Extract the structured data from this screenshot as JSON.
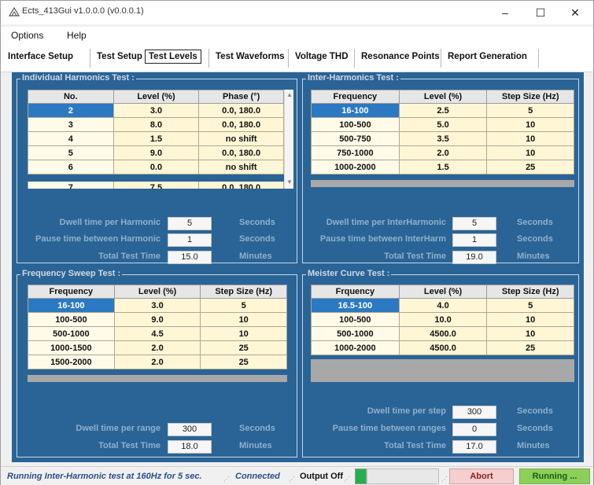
{
  "window": {
    "title": "Ects_413Gui v1.0.0.0 (v0.0.0.1)",
    "minimize": "–",
    "maximize": "☐",
    "close": "✕"
  },
  "menu": [
    "Options",
    "Help"
  ],
  "tabs": [
    "Interface Setup",
    "Test Setup",
    "Test Levels",
    "Test Waveforms",
    "Voltage THD",
    "Resonance Points",
    "Report Generation"
  ],
  "active_tab": "Test Levels",
  "individual": {
    "title": "Individual Harmonics Test :",
    "headers": [
      "No.",
      "Level (%)",
      "Phase (°)"
    ],
    "rows": [
      [
        "2",
        "3.0",
        "0.0, 180.0"
      ],
      [
        "3",
        "8.0",
        "0.0, 180.0"
      ],
      [
        "4",
        "1.5",
        "no shift"
      ],
      [
        "5",
        "9.0",
        "0.0, 180.0"
      ],
      [
        "6",
        "0.0",
        "no shift"
      ],
      [
        "7",
        "7.5",
        "0.0, 180.0"
      ]
    ],
    "dwell_label": "Dwell time per Harmonic",
    "dwell_value": "5",
    "dwell_unit": "Seconds",
    "pause_label": "Pause time between Harmonic",
    "pause_value": "1",
    "pause_unit": "Seconds",
    "total_label": "Total Test Time",
    "total_value": "15.0",
    "total_unit": "Minutes"
  },
  "inter": {
    "title": "Inter-Harmonics Test :",
    "headers": [
      "Frequency",
      "Level (%)",
      "Step Size (Hz)"
    ],
    "rows": [
      [
        "16-100",
        "2.5",
        "5"
      ],
      [
        "100-500",
        "5.0",
        "10"
      ],
      [
        "500-750",
        "3.5",
        "10"
      ],
      [
        "750-1000",
        "2.0",
        "10"
      ],
      [
        "1000-2000",
        "1.5",
        "25"
      ]
    ],
    "dwell_label": "Dwell time per InterHarmonic",
    "dwell_value": "5",
    "dwell_unit": "Seconds",
    "pause_label": "Pause time between InterHarm",
    "pause_value": "1",
    "pause_unit": "Seconds",
    "total_label": "Total Test Time",
    "total_value": "19.0",
    "total_unit": "Minutes"
  },
  "sweep": {
    "title": "Frequency Sweep Test :",
    "headers": [
      "Frequency",
      "Level (%)",
      "Step Size (Hz)"
    ],
    "rows": [
      [
        "16-100",
        "3.0",
        "5"
      ],
      [
        "100-500",
        "9.0",
        "10"
      ],
      [
        "500-1000",
        "4.5",
        "10"
      ],
      [
        "1000-1500",
        "2.0",
        "25"
      ],
      [
        "1500-2000",
        "2.0",
        "25"
      ]
    ],
    "dwell_label": "Dwell time per range",
    "dwell_value": "300",
    "dwell_unit": "Seconds",
    "total_label": "Total Test Time",
    "total_value": "18.0",
    "total_unit": "Minutes"
  },
  "meister": {
    "title": "Meister Curve Test :",
    "headers": [
      "Frquency",
      "Level (%)",
      "Step Size (Hz)"
    ],
    "rows": [
      [
        "16.5-100",
        "4.0",
        "5"
      ],
      [
        "100-500",
        "10.0",
        "10"
      ],
      [
        "500-1000",
        "4500.0",
        "10"
      ],
      [
        "1000-2000",
        "4500.0",
        "25"
      ]
    ],
    "dwell_label": "Dwell time per step",
    "dwell_value": "300",
    "dwell_unit": "Seconds",
    "pause_label": "Pause time between ranges",
    "pause_value": "0",
    "pause_unit": "Seconds",
    "total_label": "Total Test Time",
    "total_value": "17.0",
    "total_unit": "Minutes"
  },
  "status": {
    "message": "Running Inter-Harmonic test at 160Hz for 5 sec.",
    "connection": "Connected",
    "output": "Output Off",
    "abort": "Abort",
    "running": "Running ..."
  },
  "colors": {
    "panel_bg": "#2a6496",
    "selected_cell": "#2b79c2",
    "cell_bg": "#fff6d6",
    "running_btn": "#8ccf5a",
    "abort_btn": "#f6cece"
  }
}
